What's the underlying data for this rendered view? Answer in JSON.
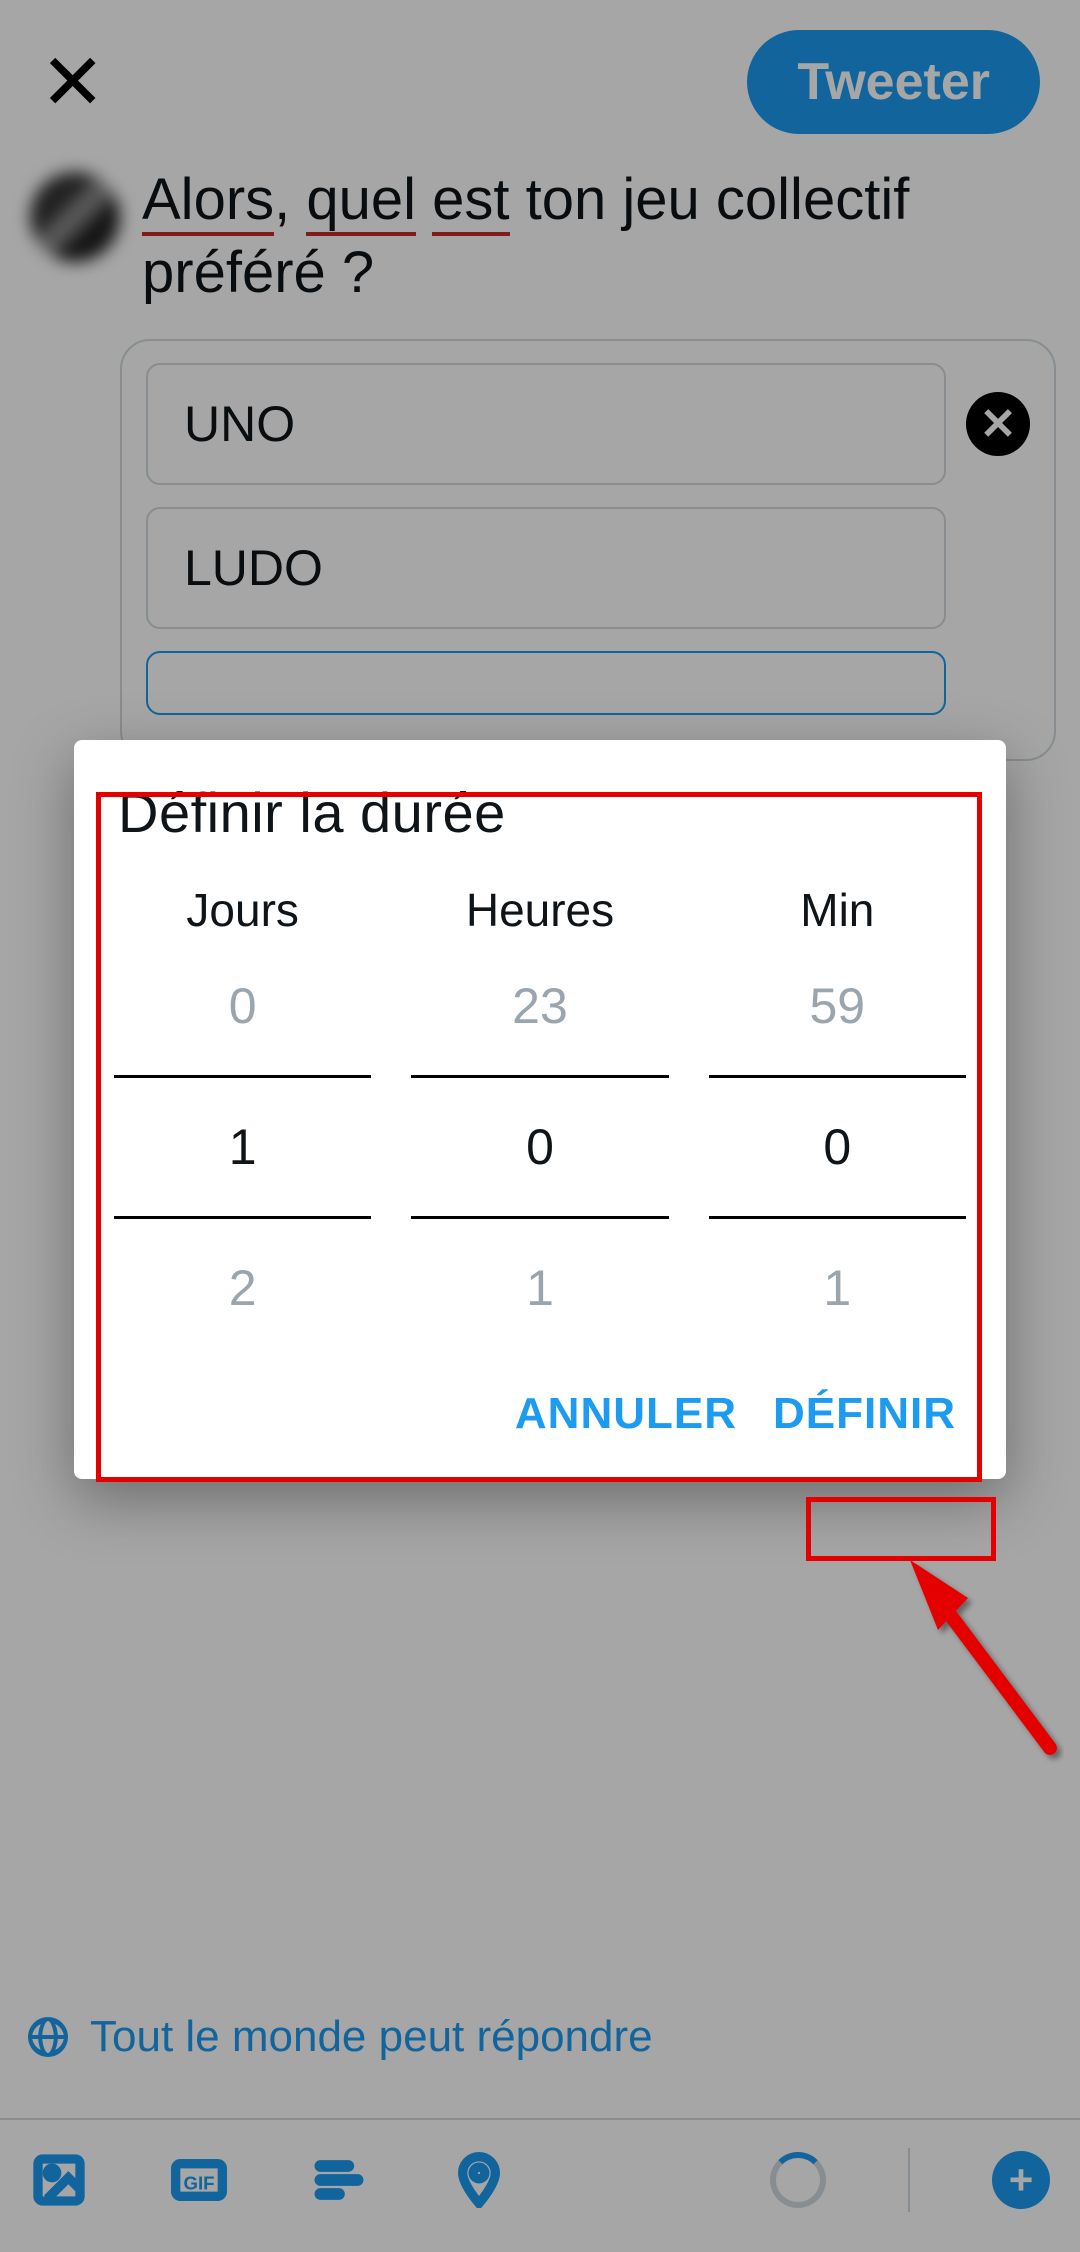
{
  "topbar": {
    "tweet_label": "Tweeter"
  },
  "compose": {
    "text_tokens": [
      {
        "t": "Alors",
        "u": true
      },
      {
        "t": ", ",
        "u": false
      },
      {
        "t": "quel",
        "u": true
      },
      {
        "t": " ",
        "u": false
      },
      {
        "t": "est",
        "u": true
      },
      {
        "t": " ton jeu collectif préféré ?",
        "u": false
      }
    ]
  },
  "poll": {
    "options": [
      {
        "value": "UNO",
        "accent": false
      },
      {
        "value": "LUDO",
        "accent": false
      },
      {
        "value": "",
        "accent": true
      }
    ]
  },
  "reply": {
    "label": "Tout le monde peut répondre"
  },
  "modal": {
    "title": "Définir la durée",
    "columns": [
      {
        "label": "Jours",
        "prev": "0",
        "sel": "1",
        "next": "2"
      },
      {
        "label": "Heures",
        "prev": "23",
        "sel": "0",
        "next": "1"
      },
      {
        "label": "Min",
        "prev": "59",
        "sel": "0",
        "next": "1"
      }
    ],
    "cancel": "ANNULER",
    "confirm": "DÉFINIR"
  }
}
